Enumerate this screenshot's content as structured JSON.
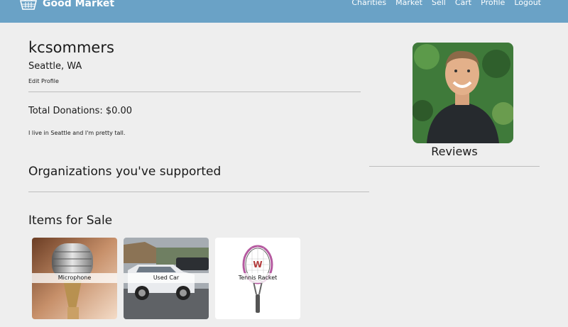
{
  "brand": {
    "name": "Good Market",
    "icon": "basket-icon"
  },
  "nav": {
    "items": [
      "Charities",
      "Market",
      "Sell",
      "Cart",
      "Profile",
      "Logout"
    ]
  },
  "profile": {
    "username": "kcsommers",
    "location": "Seattle, WA",
    "edit_label": "Edit Profile",
    "donations_label": "Total Donations: $0.00",
    "bio": "I live in Seattle and I'm pretty tall."
  },
  "sections": {
    "organizations": "Organizations you've supported",
    "items_for_sale": "Items for Sale"
  },
  "items": [
    {
      "title": "Microphone",
      "icon": "microphone-image"
    },
    {
      "title": "Used Car",
      "icon": "car-image"
    },
    {
      "title": "Tennis Racket",
      "icon": "tennis-racket-image"
    }
  ],
  "sidebar": {
    "reviews_title": "Reviews"
  },
  "colors": {
    "navbar": "#6aa2c6",
    "background": "#eeeeee"
  }
}
